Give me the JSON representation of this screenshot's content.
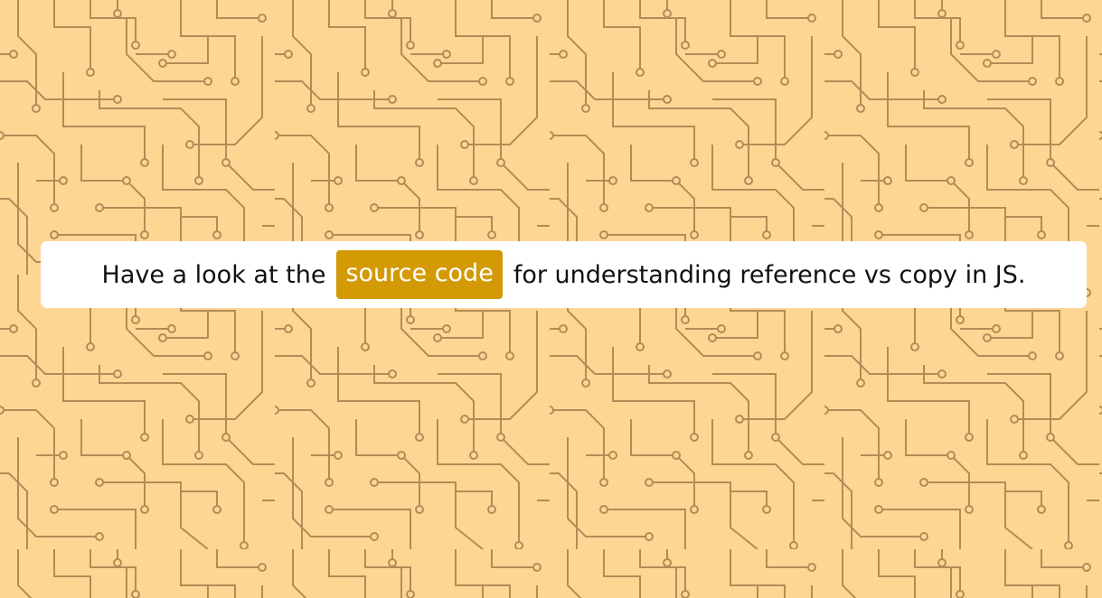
{
  "message": {
    "text_before": "Have a look at the",
    "link_label": "source code",
    "text_after": "for understanding reference vs copy in JS."
  },
  "colors": {
    "background": "#fed694",
    "circuit_trace": "#b28c55",
    "card": "#ffffff",
    "link_background": "#d39a06",
    "link_text": "#ffffff",
    "text": "#111111"
  }
}
